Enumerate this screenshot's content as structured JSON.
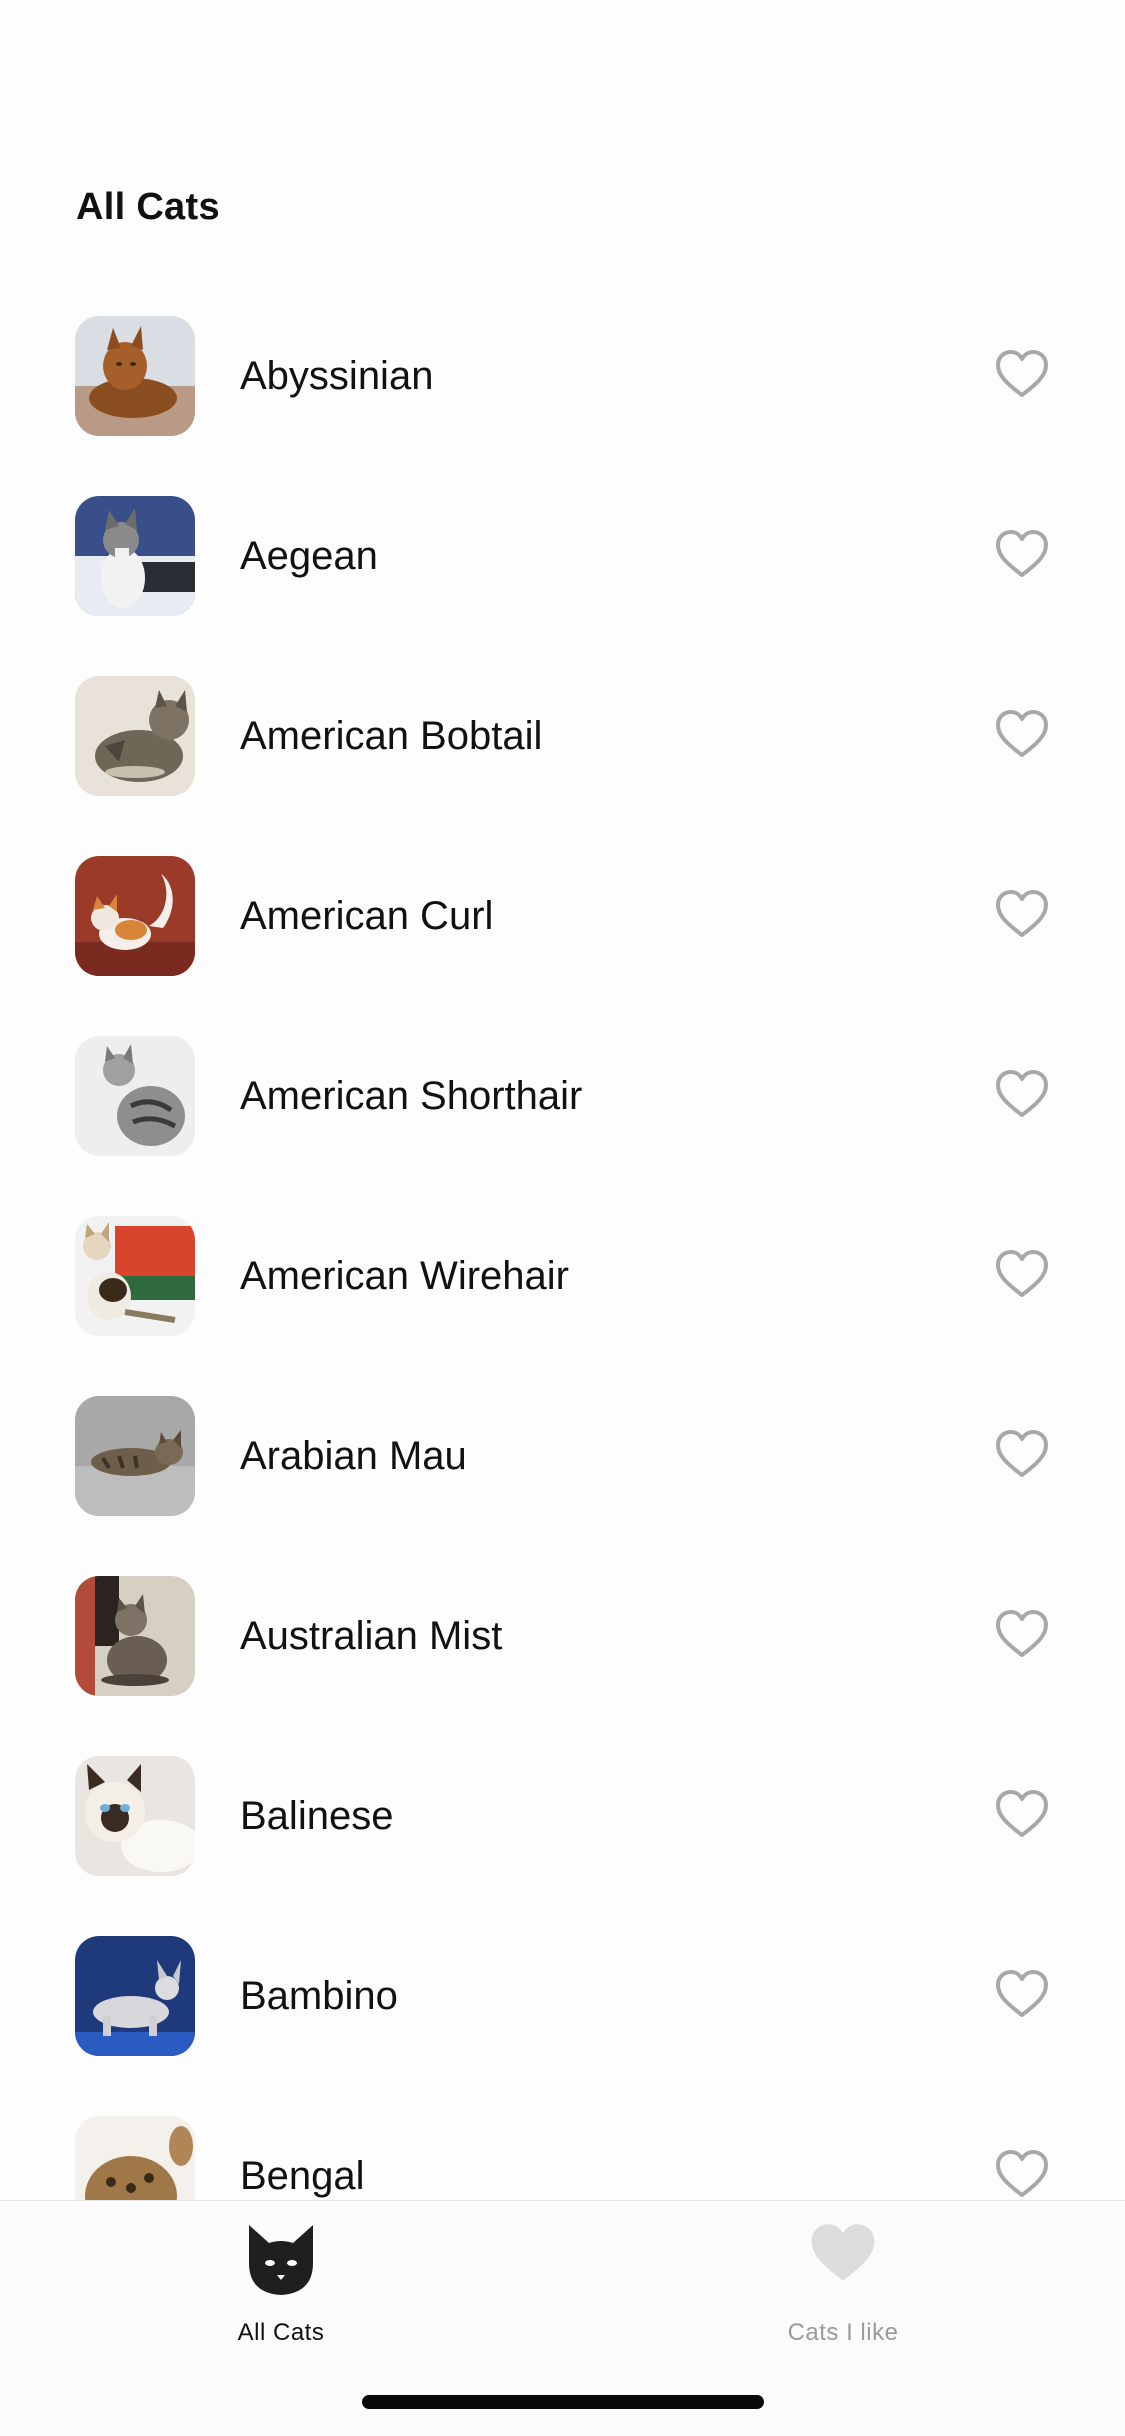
{
  "header": {
    "title": "All Cats"
  },
  "cats": [
    {
      "name": "Abyssinian",
      "liked": false
    },
    {
      "name": "Aegean",
      "liked": false
    },
    {
      "name": "American Bobtail",
      "liked": false
    },
    {
      "name": "American Curl",
      "liked": false
    },
    {
      "name": "American Shorthair",
      "liked": false
    },
    {
      "name": "American Wirehair",
      "liked": false
    },
    {
      "name": "Arabian Mau",
      "liked": false
    },
    {
      "name": "Australian Mist",
      "liked": false
    },
    {
      "name": "Balinese",
      "liked": false
    },
    {
      "name": "Bambino",
      "liked": false
    },
    {
      "name": "Bengal",
      "liked": false
    }
  ],
  "tabbar": {
    "tabs": [
      {
        "label": "All Cats",
        "icon": "cat-face-icon",
        "selected": true
      },
      {
        "label": "Cats I like",
        "icon": "heart-filled-icon",
        "selected": false
      }
    ]
  },
  "colors": {
    "heart_outline": "#a8a8a8",
    "tab_inactive": "#9a9a9a",
    "tab_active": "#111111"
  }
}
